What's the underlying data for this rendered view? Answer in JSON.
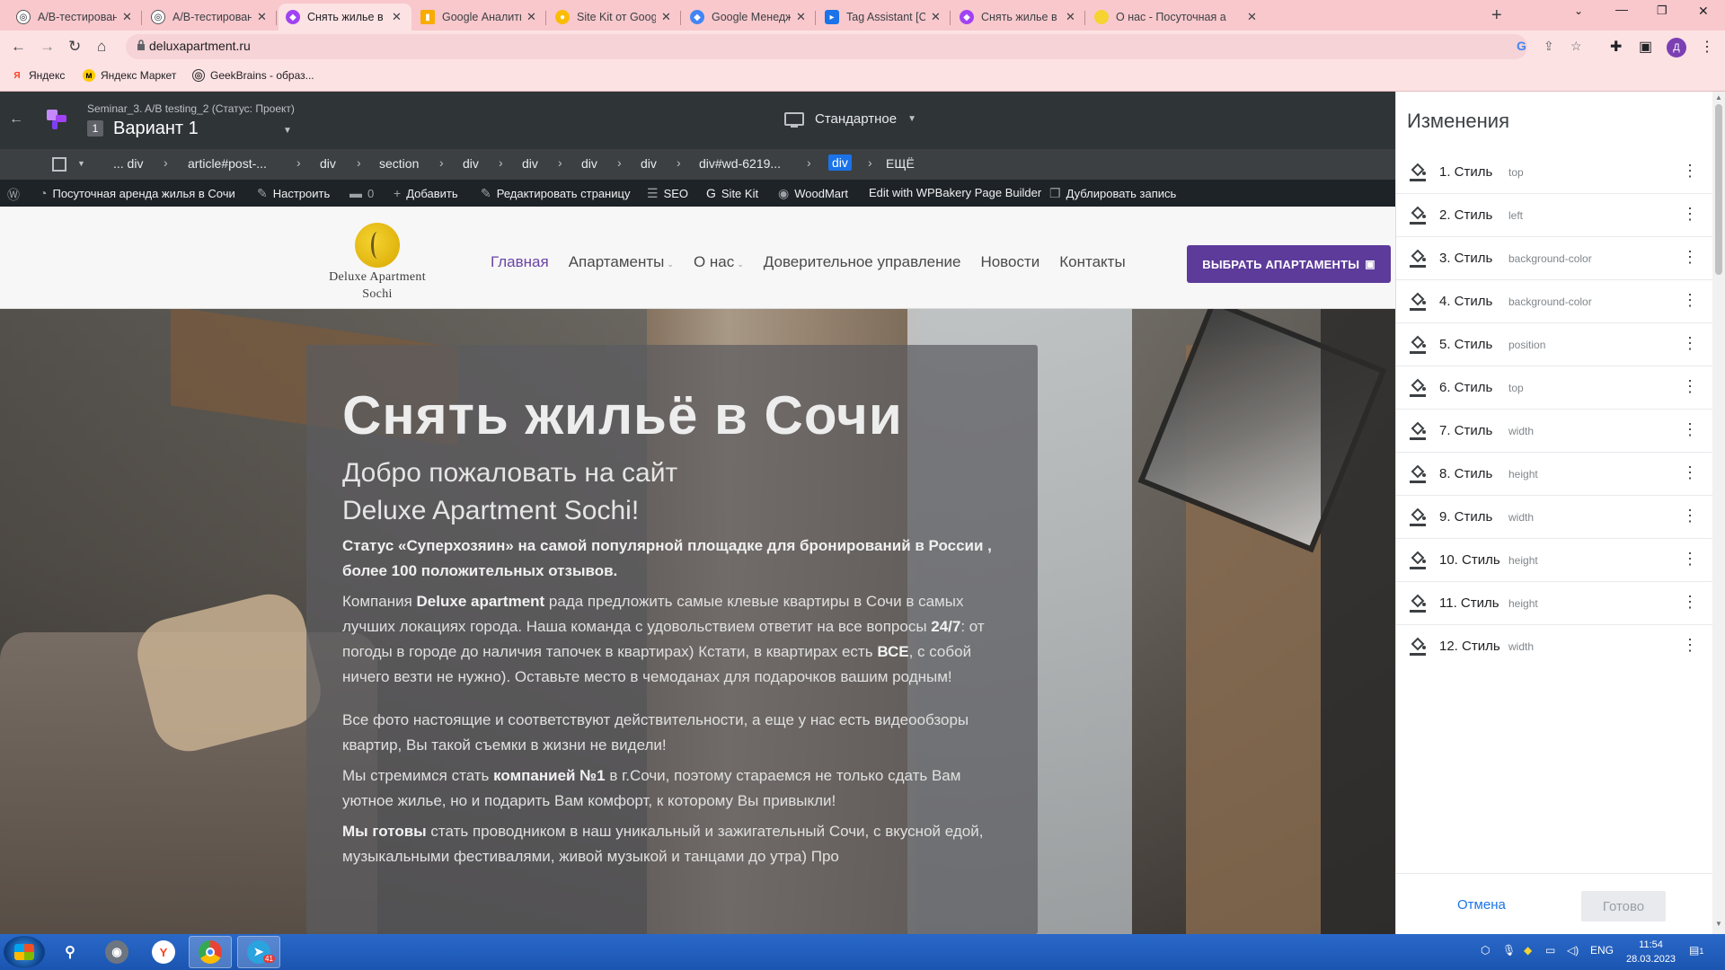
{
  "browser": {
    "tabs": [
      {
        "title": "А/В-тестирование ве",
        "icon": "openai-icon",
        "color": "#202124"
      },
      {
        "title": "А/В-тестирование ве",
        "icon": "openai-icon",
        "color": "#202124"
      },
      {
        "title": "Снять жилье в Сочи п",
        "icon": "optimize-icon",
        "color": "#a142f4",
        "active": true
      },
      {
        "title": "Google Аналитика",
        "icon": "analytics-icon",
        "color": "#f9ab00"
      },
      {
        "title": "Site Kit от Google Пан",
        "icon": "sitekit-icon",
        "color": "#fbbc04"
      },
      {
        "title": "Google Менеджер те",
        "icon": "gtm-icon",
        "color": "#4285f4"
      },
      {
        "title": "Tag Assistant [Conne",
        "icon": "tag-assistant-icon",
        "color": "#1a73e8"
      },
      {
        "title": "Снять жилье в Сочи п",
        "icon": "optimize-icon",
        "color": "#a142f4"
      },
      {
        "title": "О нас - Посуточная а",
        "icon": "site-favicon",
        "color": "#f5d331"
      }
    ],
    "url": "deluxapartment.ru",
    "bookmarks": [
      {
        "label": "Яндекс",
        "icon": "yandex-icon"
      },
      {
        "label": "Яндекс Маркет",
        "icon": "yandex-market-icon"
      },
      {
        "label": "GeekBrains - образ...",
        "icon": "geekbrains-icon"
      }
    ],
    "profile_initial": "Д"
  },
  "editor": {
    "experiment_name": "Seminar_3. A/B testing_2 (Статус: Проект)",
    "variant_number": "1",
    "variant_name": "Вариант 1",
    "device": "Стандартное",
    "breadcrumbs": [
      "... div",
      "article#post-...",
      "div",
      "section",
      "div",
      "div",
      "div",
      "div",
      "div#wd-6219...",
      "div",
      "ЕЩЁ"
    ]
  },
  "wp_admin_bar": {
    "site_name": "Посуточная аренда жилья в Сочи",
    "customize": "Настроить",
    "comments": "0",
    "add_new": "Добавить",
    "edit_page": "Редактировать страницу",
    "seo": "SEO",
    "site_kit": "Site Kit",
    "woodmart": "WoodMart",
    "wpbakery": "Edit with WPBakery Page Builder",
    "duplicate": "Дублировать запись"
  },
  "site": {
    "logo_line1": "Deluxe Apartment",
    "logo_line2": "Sochi",
    "nav": [
      {
        "label": "Главная",
        "active": true,
        "dropdown": false
      },
      {
        "label": "Апартаменты",
        "active": false,
        "dropdown": true
      },
      {
        "label": "О нас",
        "active": false,
        "dropdown": true
      },
      {
        "label": "Доверительное управление",
        "active": false,
        "dropdown": false
      },
      {
        "label": "Новости",
        "active": false,
        "dropdown": false
      },
      {
        "label": "Контакты",
        "active": false,
        "dropdown": false
      }
    ],
    "cta": "ВЫБРАТЬ АПАРТАМЕНТЫ",
    "hero": {
      "title": "Снять жильё в Сочи",
      "subtitle_line1": "Добро пожаловать на сайт",
      "subtitle_line2": "Deluxe Apartment Sochi!",
      "p1": "Статус «Суперхозяин» на самой  популярной площадке для бронирований в России , более 100 положительных отзывов.",
      "p2_a": "Компания ",
      "p2_b": "Deluxe apartment",
      "p2_c": " рада предложить самые клевые квартиры в Сочи в самых лучших локациях города. Наша команда с удовольствием ответит на все вопросы ",
      "p2_d": "24/7",
      "p2_e": ": от погоды в городе до наличия тапочек в квартирах) Кстати, в квартирах есть ",
      "p2_f": "ВСЕ",
      "p2_g": ", с собой ничего везти не нужно). Оставьте место в чемоданах для подарочков вашим  родным!",
      "p3": "Все фото настоящие и соответствуют действительности, а еще у нас есть видеообзоры квартир, Вы такой съемки в жизни не видели!",
      "p4_a": "Мы стремимся стать ",
      "p4_b": "компанией №1",
      "p4_c": " в г.Сочи, поэтому стараемся не только сдать Вам уютное жилье, но и подарить Вам комфорт, к которому Вы привыкли!",
      "p5_a": "Мы готовы",
      "p5_b": " стать проводником в наш уникальный и зажигательный Сочи, с вкусной едой, музыкальными фестивалями, живой музыкой и танцами до утра) Про"
    }
  },
  "changes_panel": {
    "title": "Изменения",
    "items": [
      {
        "label": "1. Стиль",
        "prop": "top"
      },
      {
        "label": "2. Стиль",
        "prop": "left"
      },
      {
        "label": "3. Стиль",
        "prop": "background-color"
      },
      {
        "label": "4. Стиль",
        "prop": "background-color"
      },
      {
        "label": "5. Стиль",
        "prop": "position"
      },
      {
        "label": "6. Стиль",
        "prop": "top"
      },
      {
        "label": "7. Стиль",
        "prop": "width"
      },
      {
        "label": "8. Стиль",
        "prop": "height"
      },
      {
        "label": "9. Стиль",
        "prop": "width"
      },
      {
        "label": "10. Стиль",
        "prop": "height"
      },
      {
        "label": "11. Стиль",
        "prop": "height"
      },
      {
        "label": "12. Стиль",
        "prop": "width"
      }
    ],
    "cancel": "Отмена",
    "done": "Готово"
  },
  "taskbar": {
    "lang": "ENG",
    "time": "11:54",
    "date": "28.03.2023",
    "telegram_badge": "41",
    "notifications": "1"
  }
}
